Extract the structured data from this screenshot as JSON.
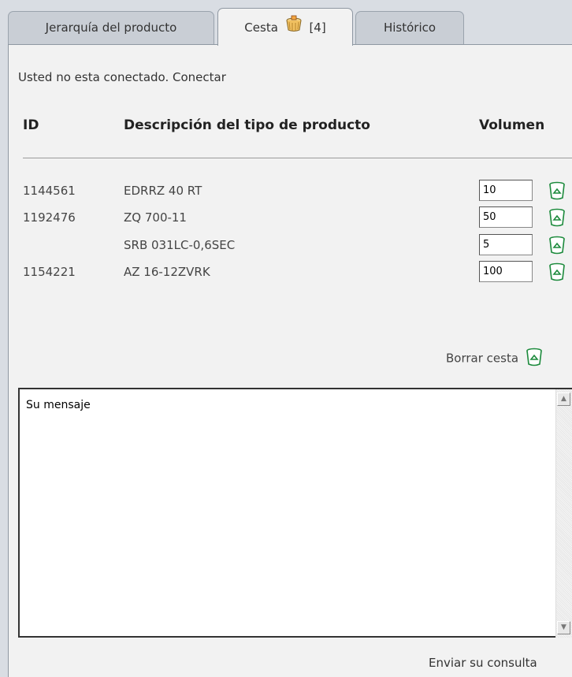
{
  "tabs": [
    {
      "label": "Jerarquía del producto"
    },
    {
      "label": "Cesta",
      "count": "[4]"
    },
    {
      "label": "Histórico"
    }
  ],
  "login": {
    "text": "Usted no esta conectado.",
    "link": "Conectar"
  },
  "table": {
    "headers": {
      "id": "ID",
      "description": "Descripción del tipo de producto",
      "volume": "Volumen"
    },
    "rows": [
      {
        "id": "1144561",
        "description": "EDRRZ 40 RT",
        "volume": "10"
      },
      {
        "id": "1192476",
        "description": "ZQ 700-11",
        "volume": "50"
      },
      {
        "id": "",
        "description": "SRB 031LC-0,6SEC",
        "volume": "5"
      },
      {
        "id": "1154221",
        "description": "AZ 16-12ZVRK",
        "volume": "100"
      }
    ]
  },
  "clear_basket": {
    "label": "Borrar cesta"
  },
  "message": {
    "placeholder": "Su mensaje"
  },
  "send": {
    "label": "Enviar su consulta"
  },
  "icons": {
    "basket": "basket-icon",
    "trash": "trash-icon",
    "scroll_up": "scroll-up-arrow-icon",
    "scroll_down": "scroll-down-arrow-icon"
  },
  "colors": {
    "trash_green": "#1c8a3c",
    "panel_bg": "#f2f2f2",
    "tab_bg": "#c9ced5"
  }
}
